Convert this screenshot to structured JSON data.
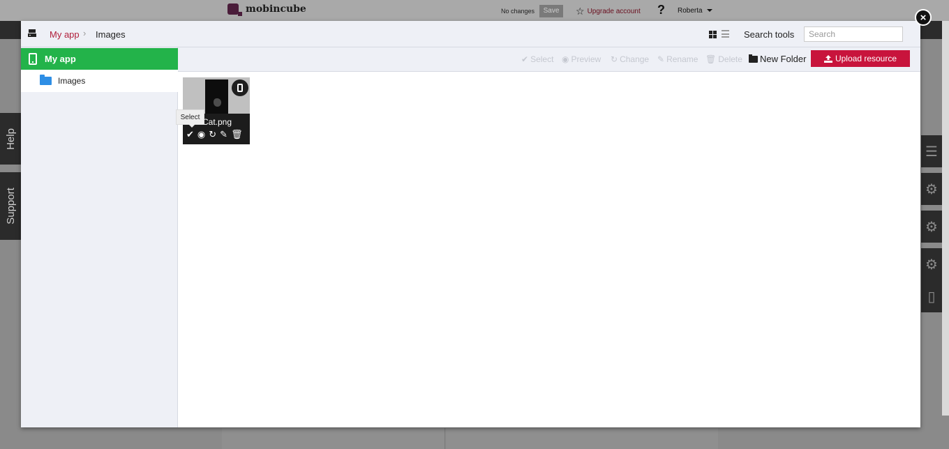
{
  "background_app": {
    "logo_text": "mobincube",
    "status_text": "No changes",
    "save_label": "Save",
    "upgrade_label": "Upgrade account",
    "help_glyph": "?",
    "user_name": "Roberta",
    "side_tabs": [
      "Help",
      "Support"
    ]
  },
  "modal": {
    "breadcrumb": {
      "root": "My app",
      "current": "Images"
    },
    "search_tools_label": "Search tools",
    "search_placeholder": "Search",
    "close_glyph": "×"
  },
  "tree": {
    "root_label": "My app",
    "items": [
      {
        "label": "Images"
      }
    ]
  },
  "toolbar": {
    "select": "Select",
    "preview": "Preview",
    "change": "Change",
    "rename": "Rename",
    "delete": "Delete",
    "new_folder": "New Folder",
    "upload": "Upload resource"
  },
  "files": [
    {
      "name": "Cat.png"
    }
  ],
  "tooltip": "Select",
  "colors": {
    "accent_red": "#c8143c",
    "tree_active_green": "#23b34a",
    "folder_blue": "#2e8ee5",
    "header_bg": "#eef0f6"
  }
}
